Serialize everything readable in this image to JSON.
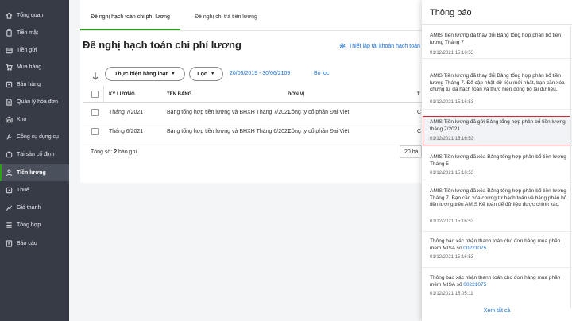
{
  "sidebar": {
    "items": [
      {
        "label": "Tổng quan",
        "icon": "home-icon"
      },
      {
        "label": "Tiền mặt",
        "icon": "cash-icon"
      },
      {
        "label": "Tiền gửi",
        "icon": "bank-icon"
      },
      {
        "label": "Mua hàng",
        "icon": "cart-icon"
      },
      {
        "label": "Bán hàng",
        "icon": "sale-icon"
      },
      {
        "label": "Quản lý hóa đơn",
        "icon": "invoice-icon"
      },
      {
        "label": "Kho",
        "icon": "warehouse-icon"
      },
      {
        "label": "Công cụ dụng cụ",
        "icon": "tools-icon"
      },
      {
        "label": "Tài sản cố định",
        "icon": "asset-icon"
      },
      {
        "label": "Tiền lương",
        "icon": "salary-icon"
      },
      {
        "label": "Thuế",
        "icon": "tax-icon"
      },
      {
        "label": "Giá thành",
        "icon": "cost-icon"
      },
      {
        "label": "Tổng hợp",
        "icon": "summary-icon"
      },
      {
        "label": "Báo cáo",
        "icon": "report-icon"
      }
    ],
    "active_index": 9
  },
  "tabs": [
    {
      "label": "Đề nghị hạch toán chi phí lương"
    },
    {
      "label": "Đề nghị chi trả tiền lương"
    }
  ],
  "page": {
    "title": "Đề nghị hạch toán chi phí lương",
    "setting_link": "Thiết lập tài khoản hạch toán"
  },
  "toolbar": {
    "batch_label": "Thực hiện hàng loạt",
    "filter_label": "Lọc",
    "date_range": "20/05/2019 - 30/06/2109",
    "clear_filter": "Bỏ lọc"
  },
  "table": {
    "columns": [
      "KỲ LƯƠNG",
      "TÊN BẢNG",
      "ĐƠN VỊ",
      "T"
    ],
    "rows": [
      {
        "period": "Tháng 7/2021",
        "name": "Bảng tổng hợp tiền lương và BHXH Tháng 7/2021",
        "unit": "Công ty cổ phần Đại Việt",
        "extra": "C"
      },
      {
        "period": "Tháng 6/2021",
        "name": "Bảng tổng hợp tiền lương và BHXH Tháng 6/2021",
        "unit": "Công ty cổ phần Đại Việt",
        "extra": "C"
      }
    ]
  },
  "footer": {
    "total_prefix": "Tổng số: ",
    "total_count": "2",
    "total_suffix": " bản ghi",
    "page_size": "20 bả"
  },
  "notifications": {
    "title": "Thông báo",
    "items": [
      {
        "text": "AMIS Tiền lương đã thay đổi Bảng tổng hợp phân bổ tiền lương Tháng 7",
        "time": "01/12/2021 15:16:53"
      },
      {
        "text": "AMIS Tiền lương đã thay đổi Bảng tổng hợp phân bổ tiền lương Tháng 7. Để cập nhật dữ liệu mới nhất, bạn cần xóa chứng từ đã hạch toán và thực hiện đồng bộ lại dữ liệu.",
        "time": "01/12/2021 15:16:53"
      },
      {
        "text": "AMIS Tiền lương đã gửi Bảng tổng hợp phân bổ tiền lương tháng 7/2021",
        "time": "01/12/2021 15:16:53"
      },
      {
        "text": "AMIS Tiền lương đã xóa Bảng tổng hợp phân bổ tiền lương Tháng 5",
        "time": "01/12/2021 15:16:53"
      },
      {
        "text": "AMIS Tiền lương đã xóa Bảng tổng hợp phân bổ tiền lương Tháng 7. Bạn cần xóa chứng từ hạch toán và bảng phân bổ tiền lương trên AMIS Kế toán để đữ liệu được chính xác.",
        "time": "01/12/2021 15:16:53"
      },
      {
        "text": "Thông báo xác nhận thanh toán cho đơn hàng mua phần mềm MISA số ",
        "number": "00221075",
        "time": "01/12/2021 15:16:53"
      },
      {
        "text": "Thông báo xác nhận thanh toán cho đơn hàng mua phần mềm MISA số ",
        "number": "00221075",
        "time": "01/12/2021 15:05:11"
      }
    ],
    "see_all": "Xem tất cả"
  },
  "colors": {
    "sidebar_bg": "#363b45",
    "accent": "#2ca01c",
    "link": "#1a6fd0",
    "highlight_border": "#d7262e"
  }
}
